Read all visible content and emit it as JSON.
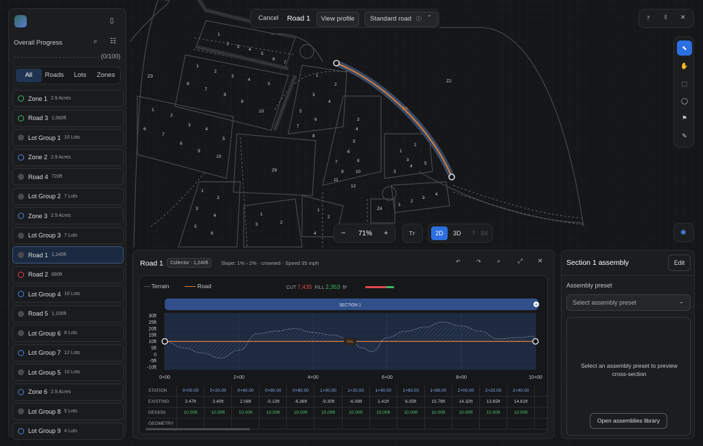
{
  "colors": {
    "accent": "#2b6fe0",
    "road": "#e0823a",
    "cut": "#e0484a",
    "fill": "#3dba6b",
    "road_shadow": "#3a4a66"
  },
  "map": {
    "zones": [
      {
        "label": "Z3"
      },
      {
        "label": "Z2"
      },
      {
        "label": "Z6"
      },
      {
        "label": "Z4"
      }
    ],
    "lots_a": [
      "1",
      "2",
      "3",
      "4",
      "5",
      "6",
      "7"
    ],
    "lots_b": [
      "1",
      "2",
      "3",
      "4",
      "5",
      "6",
      "7",
      "8",
      "9",
      "10"
    ],
    "lots_c": [
      "1",
      "2",
      "3",
      "4",
      "5",
      "6",
      "7",
      "8",
      "9",
      "10",
      "11",
      "12"
    ],
    "grade_label": "0%"
  },
  "left": {
    "progress_title": "Overall Progress",
    "progress_count": "(0/100)",
    "tabs": [
      "All",
      "Roads",
      "Lots",
      "Zones"
    ],
    "items": [
      {
        "name": "Zone 1",
        "meta": "2.9 Acres",
        "status": "green"
      },
      {
        "name": "Road 3",
        "meta": "1,560ft",
        "status": "green"
      },
      {
        "name": "Lot Group 1",
        "meta": "10 Lots",
        "status": "grey"
      },
      {
        "name": "Zone 2",
        "meta": "2.9 Acres",
        "status": "blue"
      },
      {
        "name": "Road 4",
        "meta": "720ft",
        "status": "grey"
      },
      {
        "name": "Lot Group 2",
        "meta": "7 Lots",
        "status": "grey"
      },
      {
        "name": "Zone 3",
        "meta": "2.9 Acres",
        "status": "blue"
      },
      {
        "name": "Lot Group 3",
        "meta": "7 Lots",
        "status": "grey"
      },
      {
        "name": "Road 1",
        "meta": "1,240ft",
        "status": "grey",
        "selected": true
      },
      {
        "name": "Road 2",
        "meta": "890ft",
        "status": "red"
      },
      {
        "name": "Lot Group 4",
        "meta": "10 Lots",
        "status": "blue"
      },
      {
        "name": "Road 5",
        "meta": "1,100ft",
        "status": "grey"
      },
      {
        "name": "Lot Group 6",
        "meta": "8 Lots",
        "status": "grey"
      },
      {
        "name": "Lot Group 7",
        "meta": "12 Lots",
        "status": "blue"
      },
      {
        "name": "Lot Group 5",
        "meta": "10 Lots",
        "status": "grey"
      },
      {
        "name": "Zone 6",
        "meta": "2.9 Acres",
        "status": "blue"
      },
      {
        "name": "Lot Group 8",
        "meta": "5 Lots",
        "status": "grey"
      },
      {
        "name": "Lot Group 9",
        "meta": "4 Lots",
        "status": "blue"
      }
    ]
  },
  "topbar": {
    "cancel": "Cancel",
    "title": "Road 1",
    "view_profile": "View profile",
    "road_type": "Standard road"
  },
  "zoom": {
    "minus": "−",
    "value": "71%",
    "plus": "+",
    "tt": "Tт",
    "mode_2d": "2D",
    "mode_3d": "3D",
    "mode_3x": "3X"
  },
  "profile": {
    "title": "Road 1",
    "badge": "Collector · 1,240ft",
    "info": "Slope: 1% › 2% · crowned · Speed 35 mph",
    "legend_terrain": "Terrain",
    "legend_road": "Road",
    "cut_label": "CUT",
    "cut_value": "7,435",
    "fill_label": "FILL",
    "fill_value": "2,353",
    "unit": "ft³",
    "section_label": "SECTION 1",
    "grade_label": "0%",
    "table": {
      "row_labels": [
        "STATION",
        "EXISTING",
        "DESIGN",
        "GEOMETRY"
      ],
      "station": [
        "0+00.00",
        "0+20.00",
        "0+40.00",
        "0+60.00",
        "0+80.00",
        "1+00.00",
        "1+20.00",
        "1+40.00",
        "1+60.00",
        "1+80.00",
        "2+00.00",
        "2+20.00",
        "2+40.00"
      ],
      "existing": [
        "3.47ft",
        "3.40ft",
        "2.06ft",
        "-0.13ft",
        "-6.36ft",
        "-9.30ft",
        "-6.09ft",
        "1.41ft",
        "6.05ft",
        "13.78ft",
        "14.32ft",
        "13.65ft",
        "14.81ft"
      ],
      "design": [
        "10.00ft",
        "10.00ft",
        "10.00ft",
        "10.00ft",
        "10.00ft",
        "10.00ft",
        "10.00ft",
        "10.00ft",
        "10.00ft",
        "10.00ft",
        "10.00ft",
        "10.00ft",
        "10.00ft"
      ]
    }
  },
  "chart_data": {
    "type": "area",
    "xlabel": "",
    "ylabel": "",
    "x_ticks": [
      "0+00",
      "2+00",
      "4+00",
      "6+00",
      "8+00",
      "10+00"
    ],
    "y_ticks": [
      "30ft",
      "25ft",
      "20ft",
      "15ft",
      "10ft",
      "5ft",
      "0",
      "-5ft",
      "-10ft"
    ],
    "ylim": [
      -10,
      30
    ],
    "xlim": [
      0,
      1000
    ],
    "series": [
      {
        "name": "Terrain",
        "x": [
          0,
          50,
          100,
          150,
          200,
          250,
          300,
          350,
          400,
          450,
          500,
          530,
          560,
          600,
          650,
          700,
          750,
          800,
          850,
          900,
          950,
          1000
        ],
        "values": [
          10,
          5,
          1,
          -3,
          3,
          16,
          18,
          20,
          17,
          15,
          12,
          5,
          2,
          13,
          18,
          21,
          25,
          22,
          18,
          12,
          13,
          14
        ]
      },
      {
        "name": "Road",
        "x": [
          0,
          1000
        ],
        "values": [
          10,
          10
        ]
      }
    ],
    "legend": "top-left"
  },
  "assembly": {
    "title": "Section 1 assembly",
    "edit": "Edit",
    "preset_label": "Assembly preset",
    "preset_placeholder": "Select assembly preset",
    "empty_text": "Select an assembly preset to preview cross-section",
    "library_button": "Open assemblies library"
  }
}
